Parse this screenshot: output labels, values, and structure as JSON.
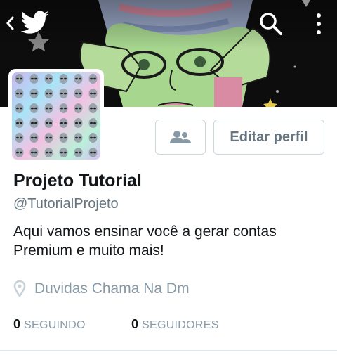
{
  "app": {
    "accent": "#1da1f2"
  },
  "nav": {
    "back_icon": "chevron-left-icon",
    "logo_icon": "twitter-bird-icon",
    "search_icon": "search-icon",
    "more_icon": "vertical-dots-icon"
  },
  "profile": {
    "display_name": "Projeto Tutorial",
    "screen_name": "@TutorialProjeto",
    "bio": "Aqui vamos ensinar você a gerar contas Premium e muito mais!",
    "location": "Duvidas Chama Na Dm",
    "location_icon": "map-pin-icon"
  },
  "actions": {
    "follow_icon": "people-icon",
    "edit_profile_label": "Editar perfil"
  },
  "stats": {
    "following_count": "0",
    "following_label": "SEGUINDO",
    "followers_count": "0",
    "followers_label": "SEGUIDORES"
  },
  "colors": {
    "secondary_text": "#66757f",
    "muted_text": "#8899a6",
    "border": "#ccd6dd"
  }
}
